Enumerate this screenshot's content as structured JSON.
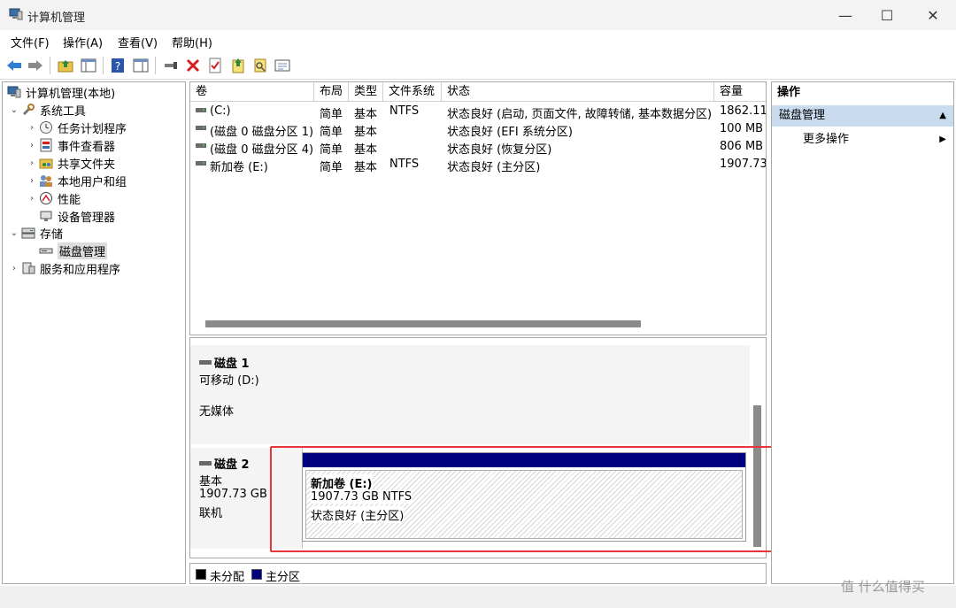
{
  "window": {
    "title": "计算机管理",
    "icon": "computer-management-icon",
    "minimize": "—",
    "maximize": "☐",
    "close": "✕"
  },
  "menu": [
    "文件(F)",
    "操作(A)",
    "查看(V)",
    "帮助(H)"
  ],
  "toolbar": [
    "back-icon",
    "forward-icon",
    "folder-up-icon",
    "show-tree-icon",
    "help-icon",
    "properties-icon",
    "connect-icon",
    "delete-icon",
    "checklist-icon",
    "export-icon",
    "search-icon",
    "list-icon"
  ],
  "tree": {
    "root": "计算机管理(本地)",
    "items": [
      {
        "label": "系统工具",
        "icon": "tools-icon",
        "level": 1,
        "state": "expanded"
      },
      {
        "label": "任务计划程序",
        "icon": "clock-icon",
        "level": 2,
        "state": "collapsed"
      },
      {
        "label": "事件查看器",
        "icon": "event-viewer-icon",
        "level": 2,
        "state": "collapsed"
      },
      {
        "label": "共享文件夹",
        "icon": "shared-folder-icon",
        "level": 2,
        "state": "collapsed"
      },
      {
        "label": "本地用户和组",
        "icon": "users-icon",
        "level": 2,
        "state": "collapsed"
      },
      {
        "label": "性能",
        "icon": "performance-icon",
        "level": 2,
        "state": "collapsed"
      },
      {
        "label": "设备管理器",
        "icon": "device-manager-icon",
        "level": 2,
        "state": "leaf"
      },
      {
        "label": "存储",
        "icon": "storage-icon",
        "level": 1,
        "state": "expanded"
      },
      {
        "label": "磁盘管理",
        "icon": "disk-icon",
        "level": 2,
        "state": "leaf",
        "selected": true
      },
      {
        "label": "服务和应用程序",
        "icon": "services-icon",
        "level": 1,
        "state": "collapsed"
      }
    ]
  },
  "volumes": {
    "columns": [
      "卷",
      "布局",
      "类型",
      "文件系统",
      "状态",
      "容量"
    ],
    "rows": [
      {
        "name": "(C:)",
        "layout": "简单",
        "type": "基本",
        "fs": "NTFS",
        "status": "状态良好 (启动, 页面文件, 故障转储, 基本数据分区)",
        "capacity": "1862.11"
      },
      {
        "name": "(磁盘 0 磁盘分区 1)",
        "layout": "简单",
        "type": "基本",
        "fs": "",
        "status": "状态良好 (EFI 系统分区)",
        "capacity": "100 MB"
      },
      {
        "name": "(磁盘 0 磁盘分区 4)",
        "layout": "简单",
        "type": "基本",
        "fs": "",
        "status": "状态良好 (恢复分区)",
        "capacity": "806 MB"
      },
      {
        "name": "新加卷 (E:)",
        "layout": "简单",
        "type": "基本",
        "fs": "NTFS",
        "status": "状态良好 (主分区)",
        "capacity": "1907.73"
      }
    ]
  },
  "disks": [
    {
      "name": "磁盘 1",
      "line1": "可移动 (D:)",
      "line2": "无媒体"
    },
    {
      "name": "磁盘 2",
      "line1": "基本",
      "line2": "1907.73 GB",
      "line3": "联机",
      "partition": {
        "name": "新加卷 (E:)",
        "size": "1907.73 GB NTFS",
        "status": "状态良好 (主分区)"
      }
    }
  ],
  "legend": [
    {
      "label": "未分配",
      "color": "#000000"
    },
    {
      "label": "主分区",
      "color": "#000080"
    }
  ],
  "actions": {
    "header": "操作",
    "section": "磁盘管理",
    "more": "更多操作"
  },
  "watermark": "值 什么值得买",
  "colors": {
    "accent_red": "#e8363a",
    "primary_partition": "#000080",
    "action_selected": "#c9dcef"
  }
}
